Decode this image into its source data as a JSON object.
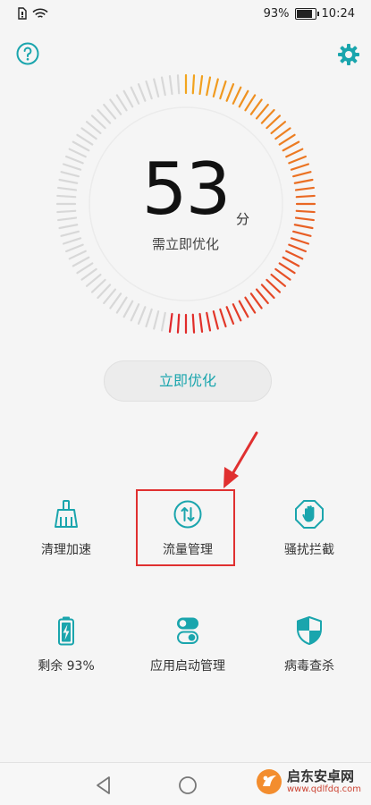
{
  "status_bar": {
    "battery_text": "93%",
    "battery_level": 0.93,
    "time": "10:24"
  },
  "score": {
    "value": "53",
    "unit": "分",
    "status": "需立即优化",
    "dial_fraction": 0.53
  },
  "dial_colors": {
    "track": "#d8d8d8",
    "warm_start": "#f2a51e",
    "warm_end": "#e0262a"
  },
  "actions": {
    "optimize_label": "立即优化"
  },
  "tools": [
    {
      "label": "清理加速",
      "icon": "broom-icon"
    },
    {
      "label": "流量管理",
      "icon": "data-transfer-icon"
    },
    {
      "label": "骚扰拦截",
      "icon": "stop-hand-icon"
    },
    {
      "label": "剩余 93%",
      "icon": "battery-icon"
    },
    {
      "label": "应用启动管理",
      "icon": "toggle-switches-icon"
    },
    {
      "label": "病毒查杀",
      "icon": "shield-icon"
    }
  ],
  "accent_color": "#1aa5ad",
  "annotation_color": "#e03030",
  "watermark": {
    "name": "启东安卓网",
    "url": "www.qdlfdq.com"
  }
}
